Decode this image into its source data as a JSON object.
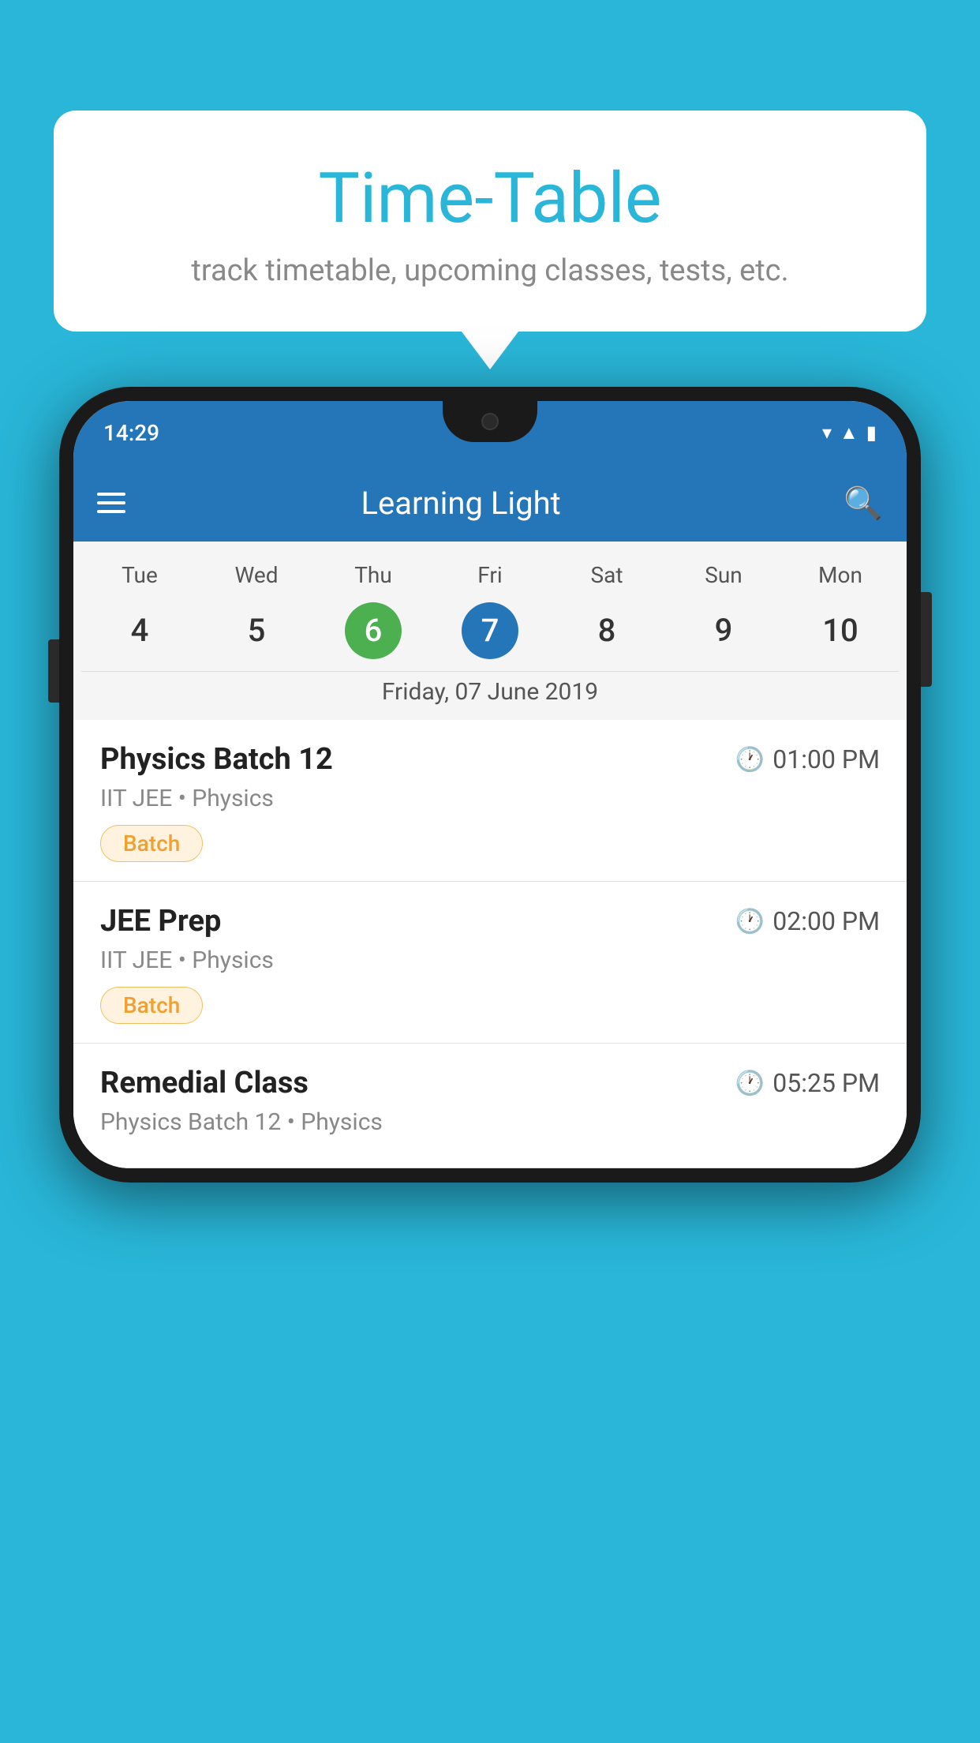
{
  "background_color": "#29b6d8",
  "bubble": {
    "title": "Time-Table",
    "subtitle": "track timetable, upcoming classes, tests, etc."
  },
  "status_bar": {
    "time": "14:29"
  },
  "app_bar": {
    "title": "Learning Light"
  },
  "calendar": {
    "days_of_week": [
      "Tue",
      "Wed",
      "Thu",
      "Fri",
      "Sat",
      "Sun",
      "Mon"
    ],
    "dates": [
      "4",
      "5",
      "6",
      "7",
      "8",
      "9",
      "10"
    ],
    "today_index": 2,
    "selected_index": 3,
    "selected_label": "Friday, 07 June 2019"
  },
  "schedule": [
    {
      "title": "Physics Batch 12",
      "time": "01:00 PM",
      "meta": "IIT JEE • Physics",
      "badge": "Batch"
    },
    {
      "title": "JEE Prep",
      "time": "02:00 PM",
      "meta": "IIT JEE • Physics",
      "badge": "Batch"
    },
    {
      "title": "Remedial Class",
      "time": "05:25 PM",
      "meta": "Physics Batch 12 • Physics",
      "badge": ""
    }
  ]
}
